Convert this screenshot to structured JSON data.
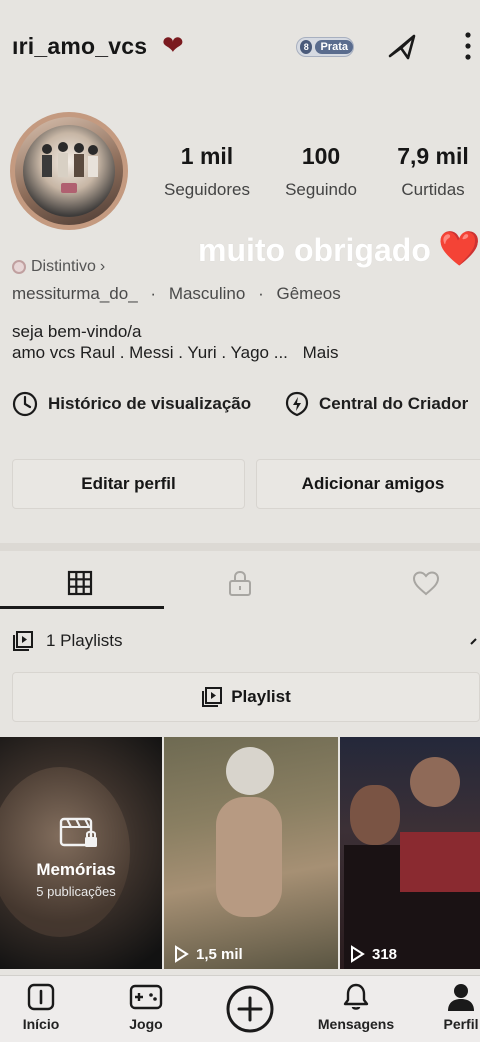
{
  "header": {
    "username": "ıri_amo_vcs",
    "heart": "❤",
    "badge_label": "Prata",
    "badge_icon": "8"
  },
  "stats": [
    {
      "value": "1 mil",
      "label": "Seguidores"
    },
    {
      "value": "100",
      "label": "Seguindo"
    },
    {
      "value": "7,9 mil",
      "label": "Curtidas"
    }
  ],
  "overlay": {
    "text": "muito obrigado",
    "heart": "❤️"
  },
  "profile": {
    "badge_label": "Distintivo",
    "badge_chevron": "›",
    "meta": [
      "messiturma_do_",
      "Masculino",
      "Gêmeos"
    ],
    "meta_sep": "·",
    "bio_line1": "seja bem-vindo/a",
    "bio_line2": "amo vcs Raul . Messi . Yuri . Yago ...",
    "bio_more": "Mais"
  },
  "links": {
    "history": "Histórico de visualização",
    "creator": "Central do Criador"
  },
  "buttons": {
    "edit": "Editar perfil",
    "add_friends": "Adicionar amigos"
  },
  "tabs": [
    {
      "icon": "grid-icon",
      "active": true
    },
    {
      "icon": "lock-icon",
      "active": false
    },
    {
      "icon": "heart-outline-icon",
      "active": false
    }
  ],
  "playlists": {
    "count_label": "1 Playlists",
    "button_label": "Playlist"
  },
  "grid": [
    {
      "title": "Memórias",
      "subtitle": "5 publicações"
    },
    {
      "views": "1,5 mil"
    },
    {
      "views": "318"
    }
  ],
  "nav": [
    {
      "label": "Início",
      "icon": "home-icon"
    },
    {
      "label": "Jogo",
      "icon": "gamepad-icon"
    },
    {
      "label": "",
      "icon": "plus-icon"
    },
    {
      "label": "Mensagens",
      "icon": "bell-icon"
    },
    {
      "label": "Perfil",
      "icon": "person-icon"
    }
  ],
  "colors": {
    "background": "#e6e4e0",
    "text": "#161616",
    "heart": "#d21a22"
  }
}
